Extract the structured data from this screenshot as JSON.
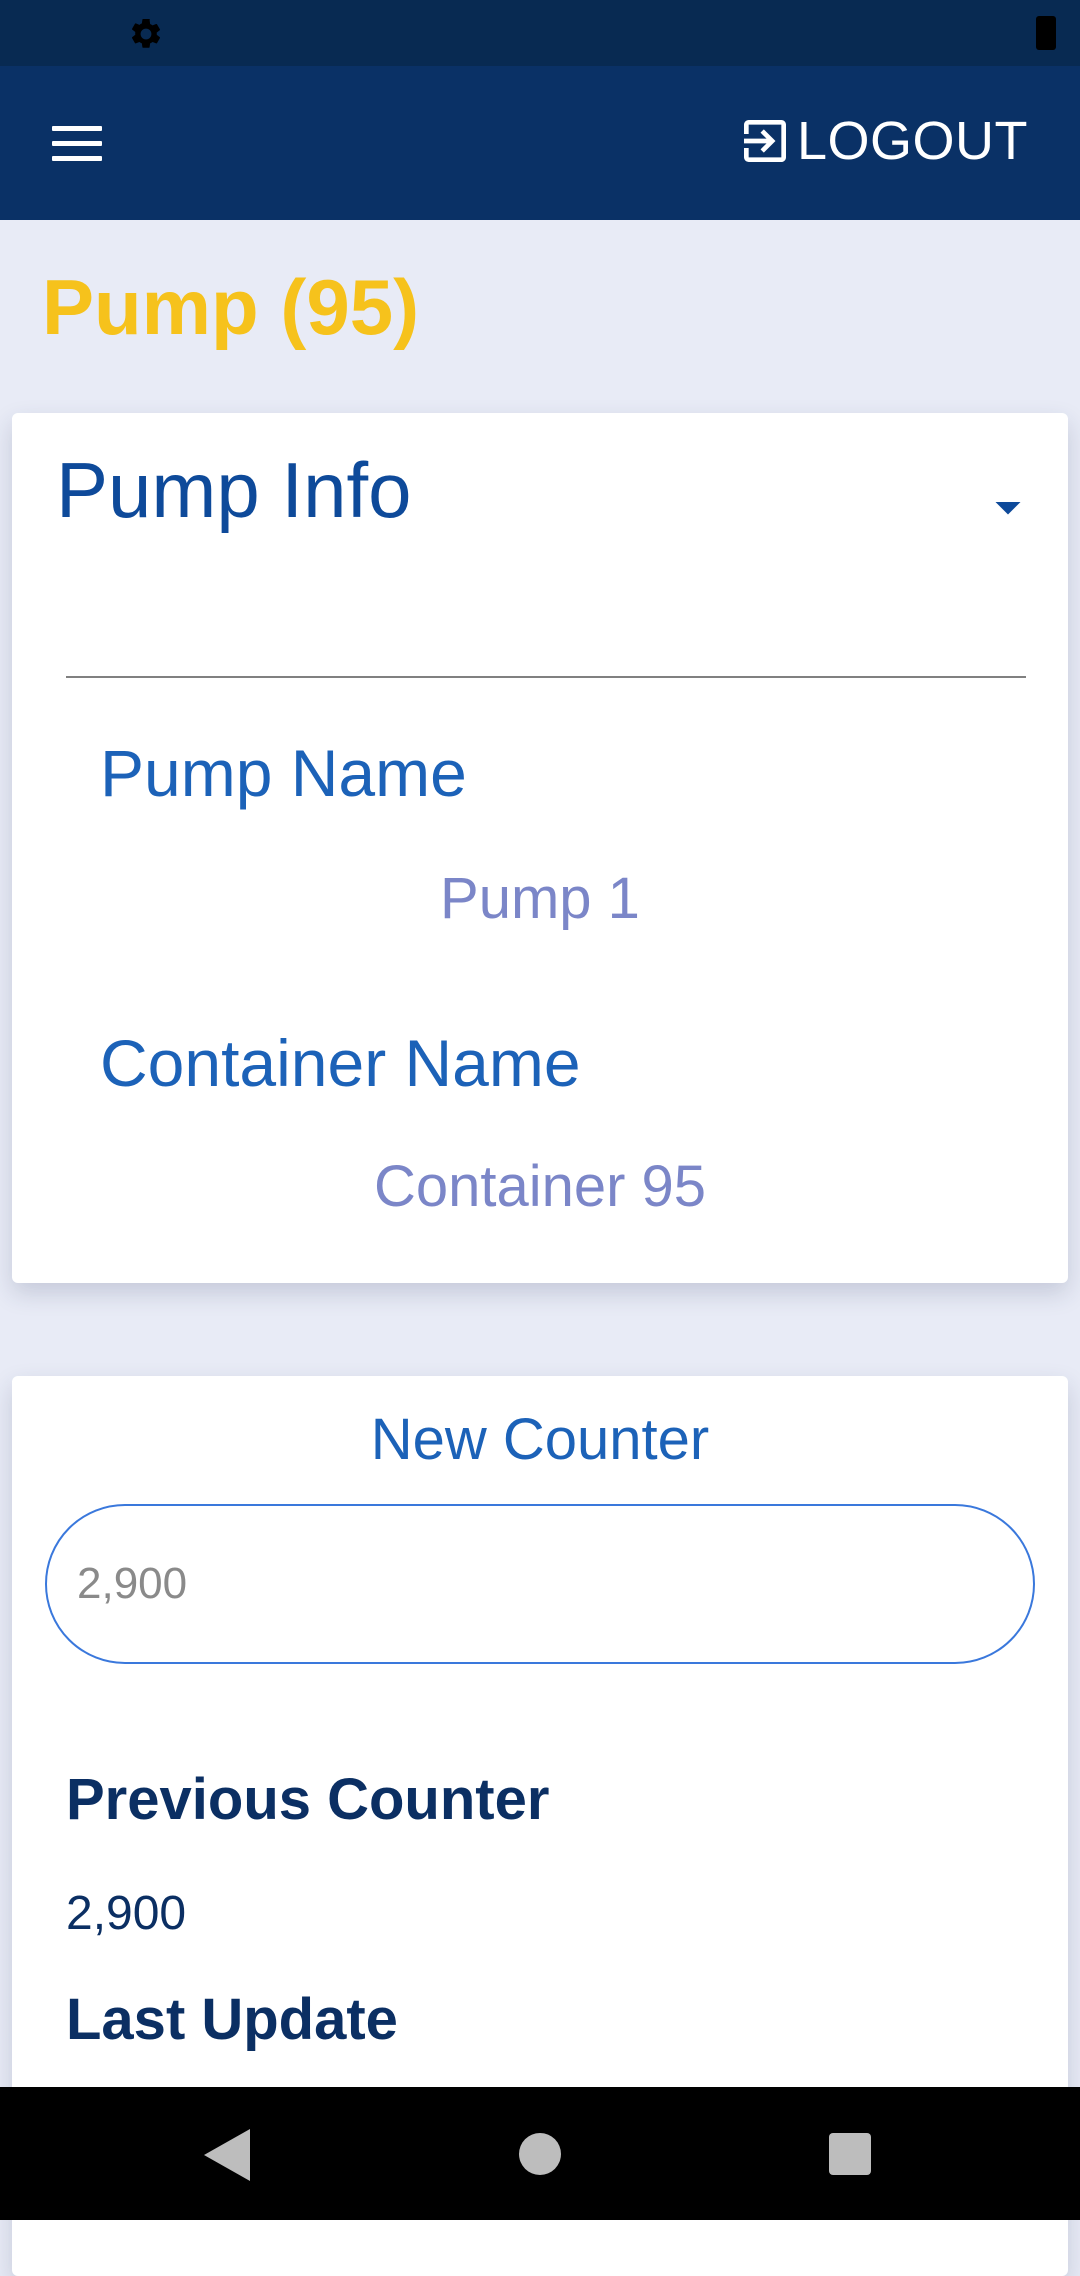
{
  "status_bar": {
    "settings_icon": "gear-icon",
    "battery_icon": "battery-icon"
  },
  "app_bar": {
    "menu_icon": "hamburger-menu-icon",
    "logout_label": "LOGOUT",
    "logout_icon": "login-arrow-icon",
    "background": "#0a3166"
  },
  "page": {
    "title": "Pump (95)",
    "title_color": "#f6c21c"
  },
  "pump_info": {
    "header": "Pump Info",
    "toggle_icon": "caret-down-icon",
    "fields": [
      {
        "label": "Pump Name",
        "value": "Pump 1"
      },
      {
        "label": "Container Name",
        "value": "Container 95"
      }
    ]
  },
  "counter": {
    "title": "New Counter",
    "input_placeholder": "2,900",
    "previous_label": "Previous Counter",
    "previous_value": "2,900",
    "last_update_label": "Last Update"
  },
  "nav_bar": {
    "back_icon": "back-triangle-icon",
    "home_icon": "home-circle-icon",
    "recent_icon": "recent-apps-square-icon"
  }
}
